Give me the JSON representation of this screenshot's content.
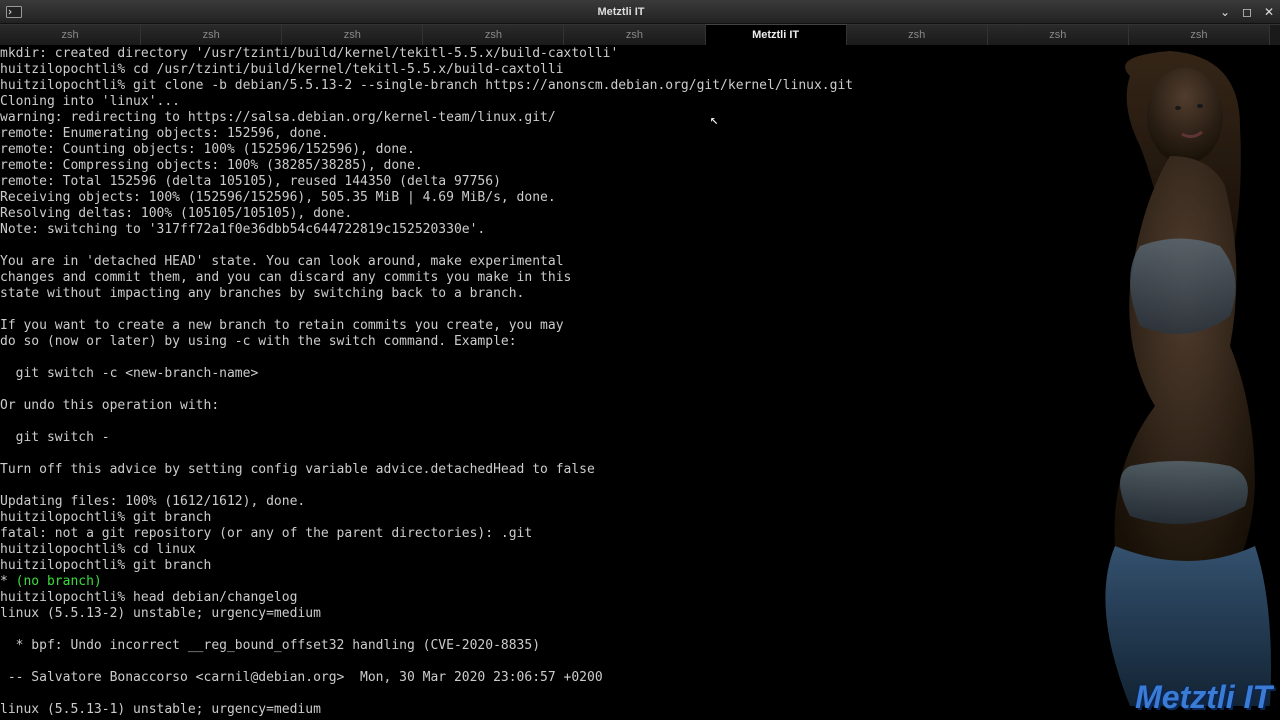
{
  "window": {
    "title": "Metztli IT"
  },
  "tabs": [
    {
      "label": "zsh",
      "active": false
    },
    {
      "label": "zsh",
      "active": false
    },
    {
      "label": "zsh",
      "active": false
    },
    {
      "label": "zsh",
      "active": false
    },
    {
      "label": "zsh",
      "active": false
    },
    {
      "label": "Metztli IT",
      "active": true
    },
    {
      "label": "zsh",
      "active": false
    },
    {
      "label": "zsh",
      "active": false
    },
    {
      "label": "zsh",
      "active": false
    }
  ],
  "prompt": "huitzilopochtli%",
  "terminal": {
    "lines": [
      "mkdir: created directory '/usr/tzinti/build/kernel/tekitl-5.5.x/build-caxtolli'",
      "huitzilopochtli% cd /usr/tzinti/build/kernel/tekitl-5.5.x/build-caxtolli",
      "huitzilopochtli% git clone -b debian/5.5.13-2 --single-branch https://anonscm.debian.org/git/kernel/linux.git",
      "Cloning into 'linux'...",
      "warning: redirecting to https://salsa.debian.org/kernel-team/linux.git/",
      "remote: Enumerating objects: 152596, done.",
      "remote: Counting objects: 100% (152596/152596), done.",
      "remote: Compressing objects: 100% (38285/38285), done.",
      "remote: Total 152596 (delta 105105), reused 144350 (delta 97756)",
      "Receiving objects: 100% (152596/152596), 505.35 MiB | 4.69 MiB/s, done.",
      "Resolving deltas: 100% (105105/105105), done.",
      "Note: switching to '317ff72a1f0e36dbb54c644722819c152520330e'.",
      "",
      "You are in 'detached HEAD' state. You can look around, make experimental",
      "changes and commit them, and you can discard any commits you make in this",
      "state without impacting any branches by switching back to a branch.",
      "",
      "If you want to create a new branch to retain commits you create, you may",
      "do so (now or later) by using -c with the switch command. Example:",
      "",
      "  git switch -c <new-branch-name>",
      "",
      "Or undo this operation with:",
      "",
      "  git switch -",
      "",
      "Turn off this advice by setting config variable advice.detachedHead to false",
      "",
      "Updating files: 100% (1612/1612), done.",
      "huitzilopochtli% git branch",
      "fatal: not a git repository (or any of the parent directories): .git",
      "huitzilopochtli% cd linux",
      "huitzilopochtli% git branch"
    ],
    "branch_line_prefix": "* ",
    "branch_line_green": "(no branch)",
    "lines_after": [
      "huitzilopochtli% head debian/changelog",
      "linux (5.5.13-2) unstable; urgency=medium",
      "",
      "  * bpf: Undo incorrect __reg_bound_offset32 handling (CVE-2020-8835)",
      "",
      " -- Salvatore Bonaccorso <carnil@debian.org>  Mon, 30 Mar 2020 23:06:57 +0200",
      "",
      "linux (5.5.13-1) unstable; urgency=medium"
    ]
  },
  "watermark": "Metztli IT"
}
